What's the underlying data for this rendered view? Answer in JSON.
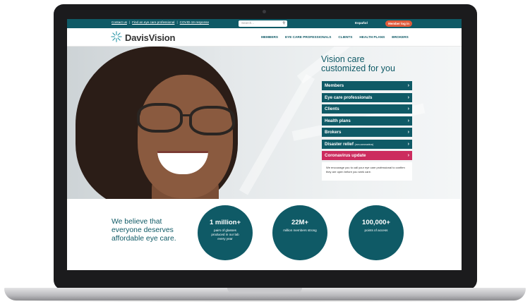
{
  "util_bar": {
    "links": [
      "Contact us",
      "Find an eye care professional",
      "COVID-19 response"
    ],
    "separator": "|",
    "search_placeholder": "Search...",
    "language": "Español",
    "member_login": "Member log in"
  },
  "nav": {
    "logo_text": "DavisVision",
    "items": [
      "MEMBERS",
      "EYE CARE PROFESSIONALS",
      "CLIENTS",
      "HEALTH PLANS",
      "BROKERS"
    ]
  },
  "hero": {
    "title_line1": "Vision care",
    "title_line2": "customized for you",
    "menu": [
      {
        "label": "Members"
      },
      {
        "label": "Eye care professionals"
      },
      {
        "label": "Clients"
      },
      {
        "label": "Health plans"
      },
      {
        "label": "Brokers"
      },
      {
        "label": "Disaster relief",
        "suffix": "(non-coronavirus)"
      },
      {
        "label": "Coronavirus update"
      }
    ],
    "chevron": "›",
    "note": "We encourage you to call your eye care professional to confirm they are open before you seek care."
  },
  "stats": {
    "belief": "We believe that everyone deserves affordable eye care.",
    "items": [
      {
        "value": "1 million+",
        "label": "pairs of glasses produced in our lab every year"
      },
      {
        "value": "22M+",
        "label": "million members strong"
      },
      {
        "value": "100,000+",
        "label": "points of access"
      }
    ]
  },
  "colors": {
    "brand_teal": "#0f5a66",
    "alert_pink": "#cc2c5e",
    "login_orange": "#e05a3a"
  }
}
